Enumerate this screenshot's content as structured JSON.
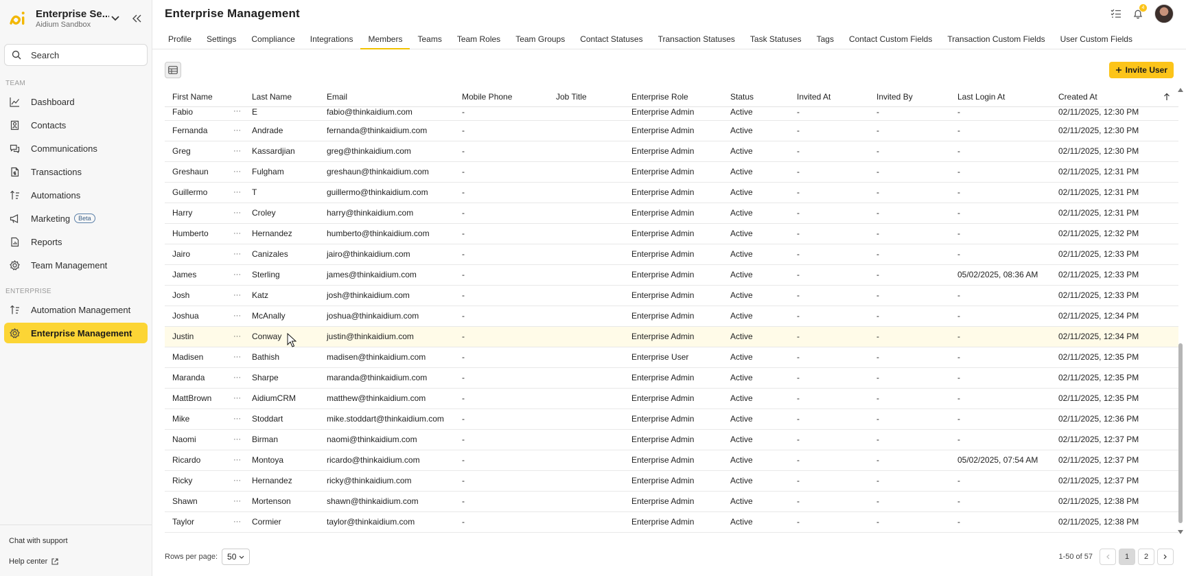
{
  "org": {
    "name": "Enterprise Se...",
    "sub": "Aidium Sandbox"
  },
  "search": {
    "placeholder": "Search"
  },
  "sidebar": {
    "team_label": "TEAM",
    "team_items": [
      {
        "label": "Dashboard",
        "icon": "chart-line-icon"
      },
      {
        "label": "Contacts",
        "icon": "contact-card-icon"
      },
      {
        "label": "Communications",
        "icon": "chat-bubbles-icon"
      },
      {
        "label": "Transactions",
        "icon": "document-dollar-icon"
      },
      {
        "label": "Automations",
        "icon": "sort-arrows-icon"
      },
      {
        "label": "Marketing",
        "icon": "megaphone-icon",
        "badge": "Beta"
      },
      {
        "label": "Reports",
        "icon": "report-icon"
      },
      {
        "label": "Team Management",
        "icon": "gear-icon"
      }
    ],
    "enterprise_label": "ENTERPRISE",
    "enterprise_items": [
      {
        "label": "Automation Management",
        "icon": "sort-arrows-icon"
      },
      {
        "label": "Enterprise Management",
        "icon": "gear-icon",
        "active": true
      }
    ],
    "chat_support": "Chat with support",
    "help_center": "Help center"
  },
  "header": {
    "title": "Enterprise Management",
    "notification_count": "4"
  },
  "tabs": [
    "Profile",
    "Settings",
    "Compliance",
    "Integrations",
    "Members",
    "Teams",
    "Team Roles",
    "Team Groups",
    "Contact Statuses",
    "Transaction Statuses",
    "Task Statuses",
    "Tags",
    "Contact Custom Fields",
    "Transaction Custom Fields",
    "User Custom Fields"
  ],
  "active_tab": "Members",
  "toolbar": {
    "invite_label": "Invite User"
  },
  "table": {
    "columns": [
      "First Name",
      "Last Name",
      "Email",
      "Mobile Phone",
      "Job Title",
      "Enterprise Role",
      "Status",
      "Invited At",
      "Invited By",
      "Last Login At",
      "Created At"
    ],
    "rows": [
      [
        "Fabio",
        "E",
        "fabio@thinkaidium.com",
        "-",
        "",
        "Enterprise Admin",
        "Active",
        "-",
        "-",
        "-",
        "02/11/2025, 12:30 PM"
      ],
      [
        "Fernanda",
        "Andrade",
        "fernanda@thinkaidium.com",
        "-",
        "",
        "Enterprise Admin",
        "Active",
        "-",
        "-",
        "-",
        "02/11/2025, 12:30 PM"
      ],
      [
        "Greg",
        "Kassardjian",
        "greg@thinkaidium.com",
        "-",
        "",
        "Enterprise Admin",
        "Active",
        "-",
        "-",
        "-",
        "02/11/2025, 12:30 PM"
      ],
      [
        "Greshaun",
        "Fulgham",
        "greshaun@thinkaidium.com",
        "-",
        "",
        "Enterprise Admin",
        "Active",
        "-",
        "-",
        "-",
        "02/11/2025, 12:31 PM"
      ],
      [
        "Guillermo",
        "T",
        "guillermo@thinkaidium.com",
        "-",
        "",
        "Enterprise Admin",
        "Active",
        "-",
        "-",
        "-",
        "02/11/2025, 12:31 PM"
      ],
      [
        "Harry",
        "Croley",
        "harry@thinkaidium.com",
        "-",
        "",
        "Enterprise Admin",
        "Active",
        "-",
        "-",
        "-",
        "02/11/2025, 12:31 PM"
      ],
      [
        "Humberto",
        "Hernandez",
        "humberto@thinkaidium.com",
        "-",
        "",
        "Enterprise Admin",
        "Active",
        "-",
        "-",
        "-",
        "02/11/2025, 12:32 PM"
      ],
      [
        "Jairo",
        "Canizales",
        "jairo@thinkaidium.com",
        "-",
        "",
        "Enterprise Admin",
        "Active",
        "-",
        "-",
        "-",
        "02/11/2025, 12:33 PM"
      ],
      [
        "James",
        "Sterling",
        "james@thinkaidium.com",
        "-",
        "",
        "Enterprise Admin",
        "Active",
        "-",
        "-",
        "05/02/2025, 08:36 AM",
        "02/11/2025, 12:33 PM"
      ],
      [
        "Josh",
        "Katz",
        "josh@thinkaidium.com",
        "-",
        "",
        "Enterprise Admin",
        "Active",
        "-",
        "-",
        "-",
        "02/11/2025, 12:33 PM"
      ],
      [
        "Joshua",
        "McAnally",
        "joshua@thinkaidium.com",
        "-",
        "",
        "Enterprise Admin",
        "Active",
        "-",
        "-",
        "-",
        "02/11/2025, 12:34 PM"
      ],
      [
        "Justin",
        "Conway",
        "justin@thinkaidium.com",
        "-",
        "",
        "Enterprise Admin",
        "Active",
        "-",
        "-",
        "-",
        "02/11/2025, 12:34 PM"
      ],
      [
        "Madisen",
        "Bathish",
        "madisen@thinkaidium.com",
        "-",
        "",
        "Enterprise User",
        "Active",
        "-",
        "-",
        "-",
        "02/11/2025, 12:35 PM"
      ],
      [
        "Maranda",
        "Sharpe",
        "maranda@thinkaidium.com",
        "-",
        "",
        "Enterprise Admin",
        "Active",
        "-",
        "-",
        "-",
        "02/11/2025, 12:35 PM"
      ],
      [
        "MattBrown",
        "AidiumCRM",
        "matthew@thinkaidium.com",
        "-",
        "",
        "Enterprise Admin",
        "Active",
        "-",
        "-",
        "-",
        "02/11/2025, 12:35 PM"
      ],
      [
        "Mike",
        "Stoddart",
        "mike.stoddart@thinkaidium.com",
        "-",
        "",
        "Enterprise Admin",
        "Active",
        "-",
        "-",
        "-",
        "02/11/2025, 12:36 PM"
      ],
      [
        "Naomi",
        "Birman",
        "naomi@thinkaidium.com",
        "-",
        "",
        "Enterprise Admin",
        "Active",
        "-",
        "-",
        "-",
        "02/11/2025, 12:37 PM"
      ],
      [
        "Ricardo",
        "Montoya",
        "ricardo@thinkaidium.com",
        "-",
        "",
        "Enterprise Admin",
        "Active",
        "-",
        "-",
        "05/02/2025, 07:54 AM",
        "02/11/2025, 12:37 PM"
      ],
      [
        "Ricky",
        "Hernandez",
        "ricky@thinkaidium.com",
        "-",
        "",
        "Enterprise Admin",
        "Active",
        "-",
        "-",
        "-",
        "02/11/2025, 12:37 PM"
      ],
      [
        "Shawn",
        "Mortenson",
        "shawn@thinkaidium.com",
        "-",
        "",
        "Enterprise Admin",
        "Active",
        "-",
        "-",
        "-",
        "02/11/2025, 12:38 PM"
      ],
      [
        "Taylor",
        "Cormier",
        "taylor@thinkaidium.com",
        "-",
        "",
        "Enterprise Admin",
        "Active",
        "-",
        "-",
        "-",
        "02/11/2025, 12:38 PM"
      ]
    ],
    "row_menu": "···",
    "highlighted_row": "Justin"
  },
  "footer": {
    "rows_per_page_label": "Rows per page:",
    "rows_per_page_value": "50",
    "range": "1-50 of 57",
    "pages": [
      "1",
      "2"
    ],
    "current_page": "1"
  },
  "colors": {
    "accent": "#fcc419",
    "active_nav": "#fcd535",
    "row_highlight": "#fffbe8"
  }
}
